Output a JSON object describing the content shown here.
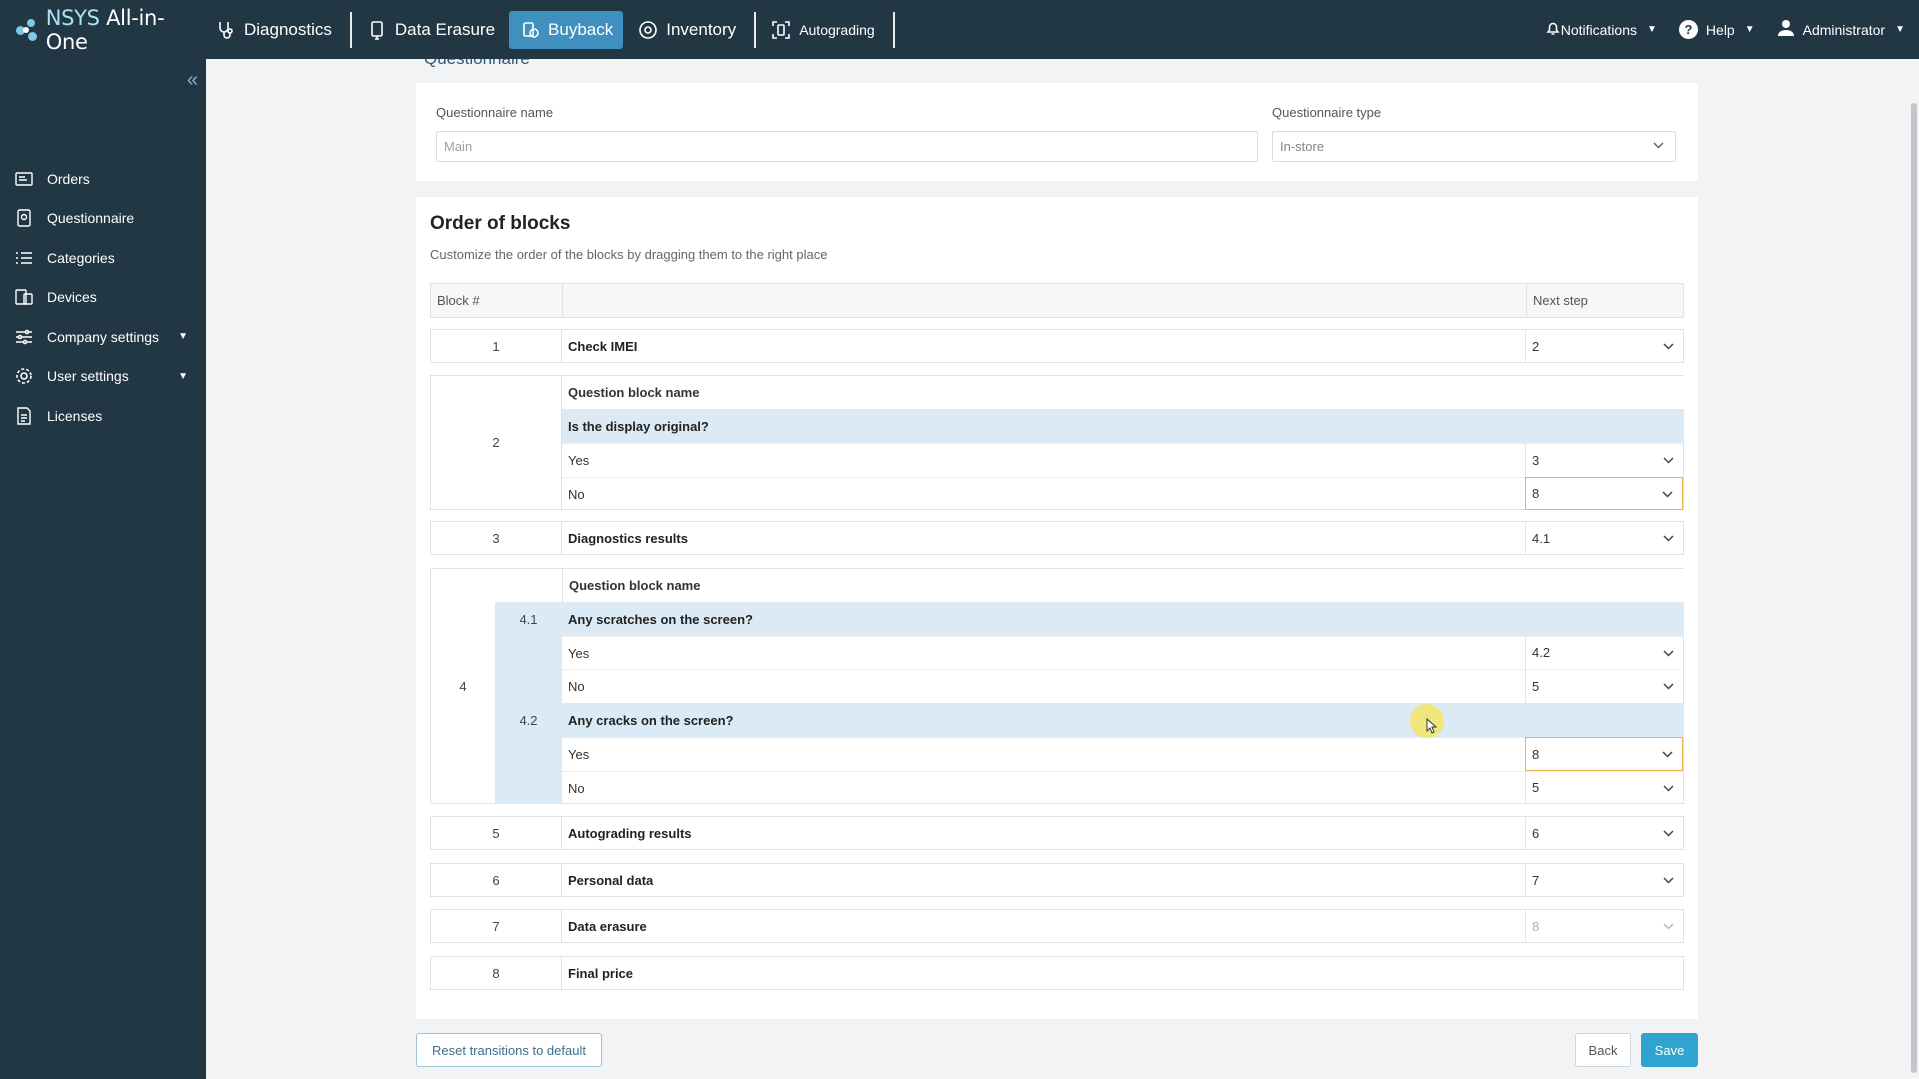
{
  "colors": {
    "nav_bg": "#213744",
    "active": "#3f8fbf",
    "accent": "#2fa4cf",
    "highlight_border": "#e8b34a",
    "row_blue": "#dbeaf4"
  },
  "brand": {
    "name_prefix": "NSYS",
    "name_suffix": "All-in-One"
  },
  "nav": [
    {
      "label": "Diagnostics",
      "icon": "stethoscope-icon"
    },
    {
      "label": "Data Erasure",
      "icon": "phone-erase-icon"
    },
    {
      "label": "Buyback",
      "icon": "buyback-icon",
      "active": true
    },
    {
      "label": "Inventory",
      "icon": "inventory-icon"
    },
    {
      "label": "Autograding",
      "icon": "autograding-icon"
    }
  ],
  "topright": {
    "notifications": "Notifications",
    "help": "Help",
    "user": "Administrator"
  },
  "sidebar": {
    "items": [
      {
        "label": "Orders",
        "icon": "orders-icon"
      },
      {
        "label": "Questionnaire",
        "icon": "questionnaire-icon"
      },
      {
        "label": "Categories",
        "icon": "list-icon"
      },
      {
        "label": "Devices",
        "icon": "devices-icon"
      },
      {
        "label": "Company settings",
        "icon": "sliders-icon",
        "expandable": true
      },
      {
        "label": "User settings",
        "icon": "gear-icon",
        "expandable": true
      },
      {
        "label": "Licenses",
        "icon": "license-icon"
      }
    ]
  },
  "questionnaire": {
    "section_title": "Questionnaire",
    "name_label": "Questionnaire name",
    "name_placeholder": "Main",
    "type_label": "Questionnaire type",
    "type_value": "In-store"
  },
  "blocks": {
    "title": "Order of blocks",
    "description": "Customize the order of the blocks by dragging them to the right place",
    "col_block": "Block #",
    "col_next": "Next step",
    "qb_header": "Question block name",
    "rows": {
      "b1": {
        "num": "1",
        "name": "Check IMEI",
        "next": "2"
      },
      "b2": {
        "num": "2",
        "question": "Is the display original?",
        "yes": "Yes",
        "yes_next": "3",
        "no": "No",
        "no_next": "8"
      },
      "b3": {
        "num": "3",
        "name": "Diagnostics results",
        "next": "4.1"
      },
      "b4": {
        "num": "4",
        "q1": {
          "num": "4.1",
          "question": "Any scratches on the screen?",
          "yes": "Yes",
          "yes_next": "4.2",
          "no": "No",
          "no_next": "5"
        },
        "q2": {
          "num": "4.2",
          "question": "Any cracks on the screen?",
          "yes": "Yes",
          "yes_next": "8",
          "no": "No",
          "no_next": "5"
        }
      },
      "b5": {
        "num": "5",
        "name": "Autograding results",
        "next": "6"
      },
      "b6": {
        "num": "6",
        "name": "Personal data",
        "next": "7"
      },
      "b7": {
        "num": "7",
        "name": "Data erasure",
        "next": "8"
      },
      "b8": {
        "num": "8",
        "name": "Final price"
      }
    }
  },
  "actions": {
    "reset": "Reset transitions to default",
    "back": "Back",
    "save": "Save"
  }
}
